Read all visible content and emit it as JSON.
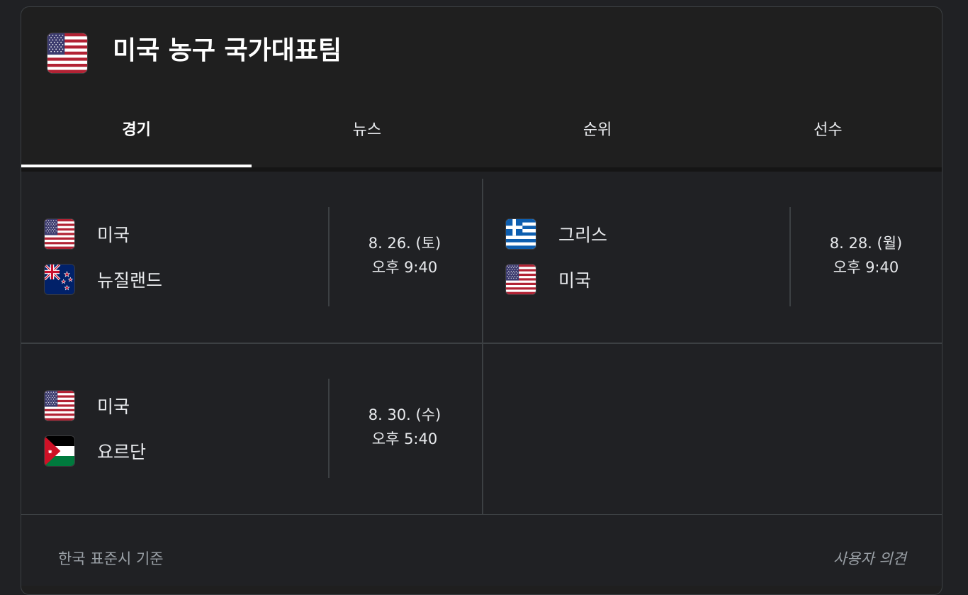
{
  "header": {
    "title": "미국 농구 국가대표팀",
    "flag_icon": "us-flag-icon"
  },
  "tabs": [
    {
      "label": "경기",
      "active": true
    },
    {
      "label": "뉴스",
      "active": false
    },
    {
      "label": "순위",
      "active": false
    },
    {
      "label": "선수",
      "active": false
    }
  ],
  "matches": [
    {
      "team1": {
        "name": "미국",
        "flag": "us-flag-icon"
      },
      "team2": {
        "name": "뉴질랜드",
        "flag": "new-zealand-flag-icon"
      },
      "date": "8. 26. (토)",
      "time": "오후 9:40"
    },
    {
      "team1": {
        "name": "그리스",
        "flag": "greece-flag-icon"
      },
      "team2": {
        "name": "미국",
        "flag": "us-flag-icon"
      },
      "date": "8. 28. (월)",
      "time": "오후 9:40"
    },
    {
      "team1": {
        "name": "미국",
        "flag": "us-flag-icon"
      },
      "team2": {
        "name": "요르단",
        "flag": "jordan-flag-icon"
      },
      "date": "8. 30. (수)",
      "time": "오후 5:40"
    }
  ],
  "footer": {
    "note": "한국 표준시 기준",
    "feedback": "사용자 의견"
  },
  "colors": {
    "background": "#202124",
    "card": "#1f1f1f",
    "divider": "#3c4043",
    "text": "#e8eaed",
    "muted": "#9aa0a6"
  }
}
